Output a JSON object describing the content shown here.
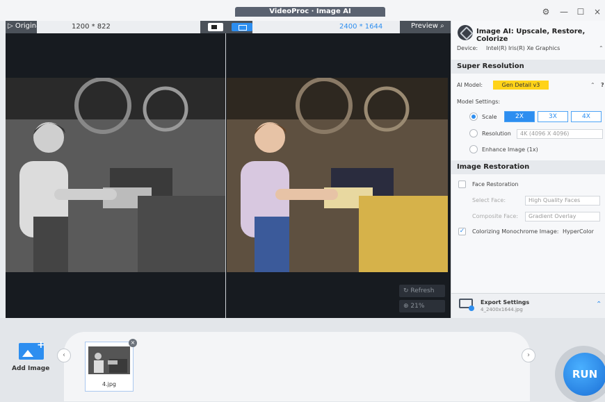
{
  "window": {
    "title": "VideoProc · Image AI"
  },
  "controls": {
    "settings_icon": "gear-icon",
    "minimize": "—",
    "maximize": "☐",
    "close": "×"
  },
  "preview_header": {
    "original_label": "▷ Original",
    "original_resolution": "1200 * 822",
    "output_resolution": "2400 * 1644",
    "preview_label": "Preview ⌕"
  },
  "preview": {
    "refresh_label": "Refresh",
    "zoom_label": "21%"
  },
  "panel": {
    "title": "Image AI: Upscale, Restore, Colorize",
    "device_label": "Device:",
    "device_value": "Intel(R) Iris(R) Xe Graphics",
    "super_resolution": {
      "heading": "Super Resolution",
      "ai_model_label": "AI Model:",
      "ai_model_value": "Gen Detail v3",
      "help": "?",
      "model_settings_label": "Model Settings:",
      "scale_label": "Scale",
      "scale_options": [
        "2X",
        "3X",
        "4X"
      ],
      "resolution_label": "Resolution",
      "resolution_value": "4K (4096 X 4096)",
      "enhance_label": "Enhance Image (1x)"
    },
    "image_restoration": {
      "heading": "Image Restoration",
      "face_restoration_label": "Face Restoration",
      "select_face_label": "Select Face:",
      "select_face_value": "High Quality Faces",
      "composite_face_label": "Composite Face:",
      "composite_face_value": "Gradient Overlay",
      "colorizing_label": "Colorizing Monochrome Image:",
      "colorizing_value": "HyperColor"
    },
    "export": {
      "title": "Export Settings",
      "filename": "4_2400x1644.jpg"
    }
  },
  "bottom": {
    "add_image_label": "Add Image",
    "thumbnail_label": "4.jpg",
    "run_label": "RUN"
  },
  "colors": {
    "accent": "#2d8ef0",
    "highlight": "#ffd319"
  }
}
